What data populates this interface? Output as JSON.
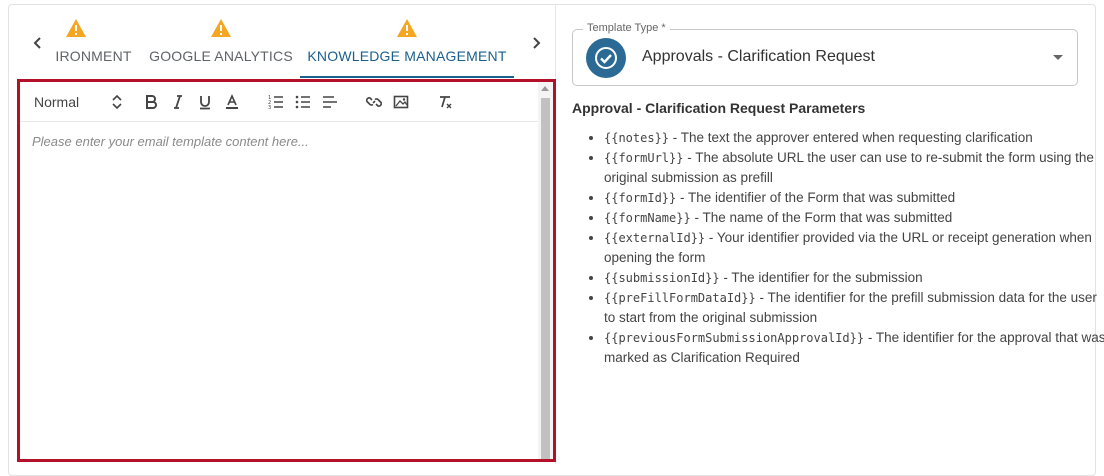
{
  "tabs": [
    {
      "label": "ENVIRONMENT",
      "warning": true,
      "active": false
    },
    {
      "label": "GOOGLE ANALYTICS",
      "warning": true,
      "active": false
    },
    {
      "label": "KNOWLEDGE MANAGEMENT",
      "warning": true,
      "active": true
    }
  ],
  "editor": {
    "format_label": "Normal",
    "placeholder": "Please enter your email template content here...",
    "toolbar_icons": [
      "bold-icon",
      "italic-icon",
      "underline-icon",
      "text-color-icon",
      "ordered-list-icon",
      "bullet-list-icon",
      "align-icon",
      "link-icon",
      "image-icon",
      "clear-format-icon"
    ]
  },
  "template_type": {
    "label": "Template Type *",
    "value": "Approvals - Clarification Request",
    "icon": "check-circle-icon"
  },
  "params": {
    "title": "Approval - Clarification Request Parameters",
    "items": [
      {
        "code": "{{notes}}",
        "desc": " - The text the approver entered when requesting clarification"
      },
      {
        "code": "{{formUrl}}",
        "desc": " - The absolute URL the user can use to re-submit the form using the original submission as prefill"
      },
      {
        "code": "{{formId}}",
        "desc": " - The identifier of the Form that was submitted"
      },
      {
        "code": "{{formName}}",
        "desc": " - The name of the Form that was submitted"
      },
      {
        "code": "{{externalId}}",
        "desc": " - Your identifier provided via the URL or receipt generation when opening the form"
      },
      {
        "code": "{{submissionId}}",
        "desc": " - The identifier for the submission"
      },
      {
        "code": "{{preFillFormDataId}}",
        "desc": " - The identifier for the prefill submission data for the user to start from the original submission"
      },
      {
        "code": "{{previousFormSubmissionApprovalId}}",
        "desc": " - The identifier for the approval that was marked as Clarification Required"
      }
    ]
  },
  "colors": {
    "accent": "#1b5f8c",
    "warning": "#f5a623",
    "editor_border": "#b3102a",
    "icon_bg": "#2a6a94"
  }
}
